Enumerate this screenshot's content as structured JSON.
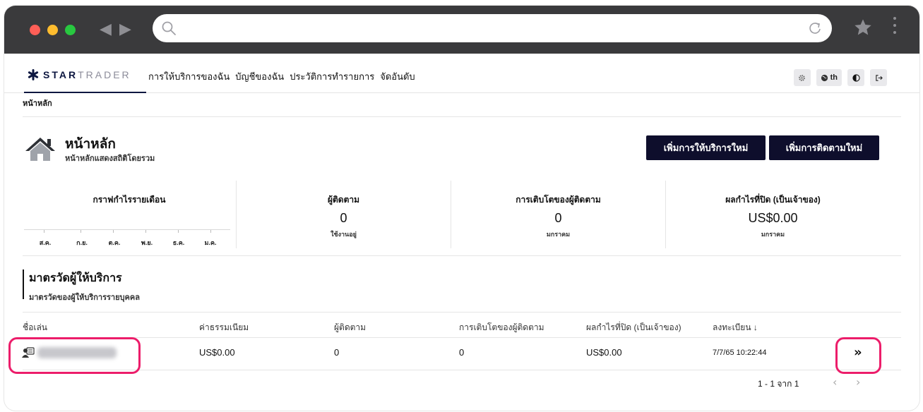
{
  "browser": {
    "url": ""
  },
  "nav": {
    "logo_bold": "STAR",
    "logo_light": "TRADER",
    "menu": [
      "การให้บริการของฉัน",
      "บัญชีของฉัน",
      "ประวัติการทำรายการ",
      "จัดอันดับ"
    ],
    "lang_label": "th"
  },
  "breadcrumb": "หน้าหลัก",
  "page": {
    "title": "หน้าหลัก",
    "subtitle": "หน้าหลักแสดงสถิติโดยรวม",
    "btn_new_service": "เพิ่มการให้บริการใหม่",
    "btn_new_follow": "เพิ่มการติดตามใหม่"
  },
  "stats": {
    "chart": {
      "label": "กราฟกำไรรายเดือน",
      "months": [
        "ส.ค.",
        "ก.ย.",
        "ต.ค.",
        "พ.ย.",
        "ธ.ค.",
        "ม.ค."
      ]
    },
    "followers": {
      "label": "ผู้ติดตาม",
      "value": "0",
      "sub": "ใช้งานอยู่"
    },
    "growth": {
      "label": "การเติบโตของผู้ติดตาม",
      "value": "0",
      "sub": "มกราคม"
    },
    "profit": {
      "label": "ผลกำไรที่ปิด (เป็นเจ้าของ)",
      "value": "US$0.00",
      "sub": "มกราคม"
    }
  },
  "metrics": {
    "title": "มาตรวัดผู้ให้บริการ",
    "subtitle": "มาตรวัดของผู้ให้บริการรายบุคคล",
    "columns": [
      "ชื่อเล่น",
      "ค่าธรรมเนียม",
      "ผู้ติดตาม",
      "การเติบโตของผู้ติดตาม",
      "ผลกำไรที่ปิด (เป็นเจ้าของ)",
      "ลงทะเบียน ↓"
    ],
    "rows": [
      {
        "fee": "US$0.00",
        "followers": "0",
        "growth": "0",
        "profit": "US$0.00",
        "registered": "7/7/65 10:22:44",
        "action": "»"
      }
    ],
    "pagination": "1 - 1 จาก 1"
  },
  "colors": {
    "brand_navy": "#0d1740",
    "button_dark": "#0e0e2c",
    "highlight": "#ec1d6a"
  }
}
